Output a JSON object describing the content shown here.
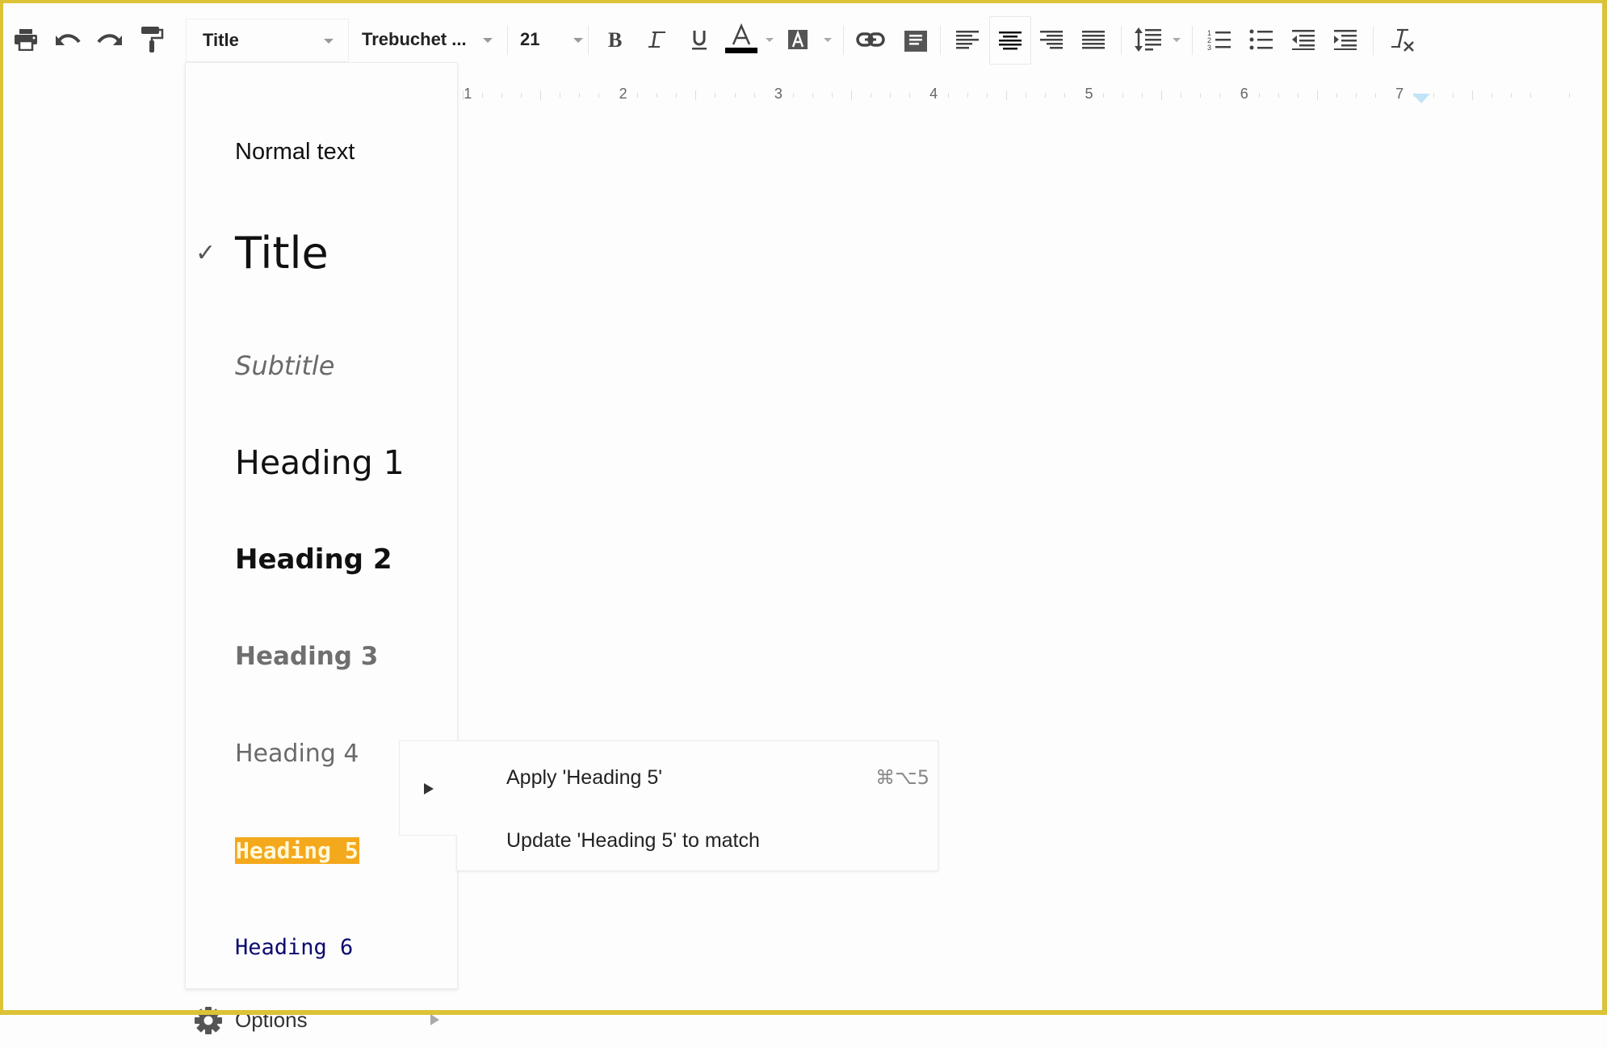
{
  "toolbar": {
    "icons": [
      "print-icon",
      "undo-icon",
      "redo-icon",
      "paint-format-icon"
    ],
    "style_select": {
      "value": "Title"
    },
    "font_select": {
      "value": "Trebuchet ..."
    },
    "size_select": {
      "value": "21"
    },
    "format_buttons": [
      "bold",
      "italic",
      "underline",
      "text-color",
      "highlight-color",
      "link",
      "comment"
    ],
    "text_color": "#000000",
    "align_buttons": [
      "align-left",
      "align-center",
      "align-right",
      "justify"
    ],
    "active_alignment": "align-center",
    "other_buttons": [
      "line-spacing",
      "numbered-list",
      "bulleted-list",
      "decrease-indent",
      "increase-indent",
      "clear-formatting"
    ]
  },
  "ruler": {
    "numbers": [
      "1",
      "2",
      "3",
      "4",
      "5",
      "6",
      "7"
    ],
    "indent_marker_color": "#bfe3f7"
  },
  "style_menu": {
    "items": [
      {
        "label": "Normal text",
        "checked": false
      },
      {
        "label": "Title",
        "checked": true
      },
      {
        "label": "Subtitle",
        "checked": false
      },
      {
        "label": "Heading 1",
        "checked": false
      },
      {
        "label": "Heading 2",
        "checked": false
      },
      {
        "label": "Heading 3",
        "checked": false
      },
      {
        "label": "Heading 4",
        "checked": false
      },
      {
        "label": "Heading 5",
        "checked": false,
        "highlight": "#f4a81c"
      },
      {
        "label": "Heading 6",
        "checked": false,
        "color": "#0a0a6e"
      }
    ],
    "check_glyph": "✓",
    "options_label": "Options"
  },
  "submenu": {
    "items": [
      {
        "label": "Apply 'Heading 5'",
        "shortcut": "⌘⌥5"
      },
      {
        "label": "Update 'Heading 5' to match"
      }
    ]
  }
}
